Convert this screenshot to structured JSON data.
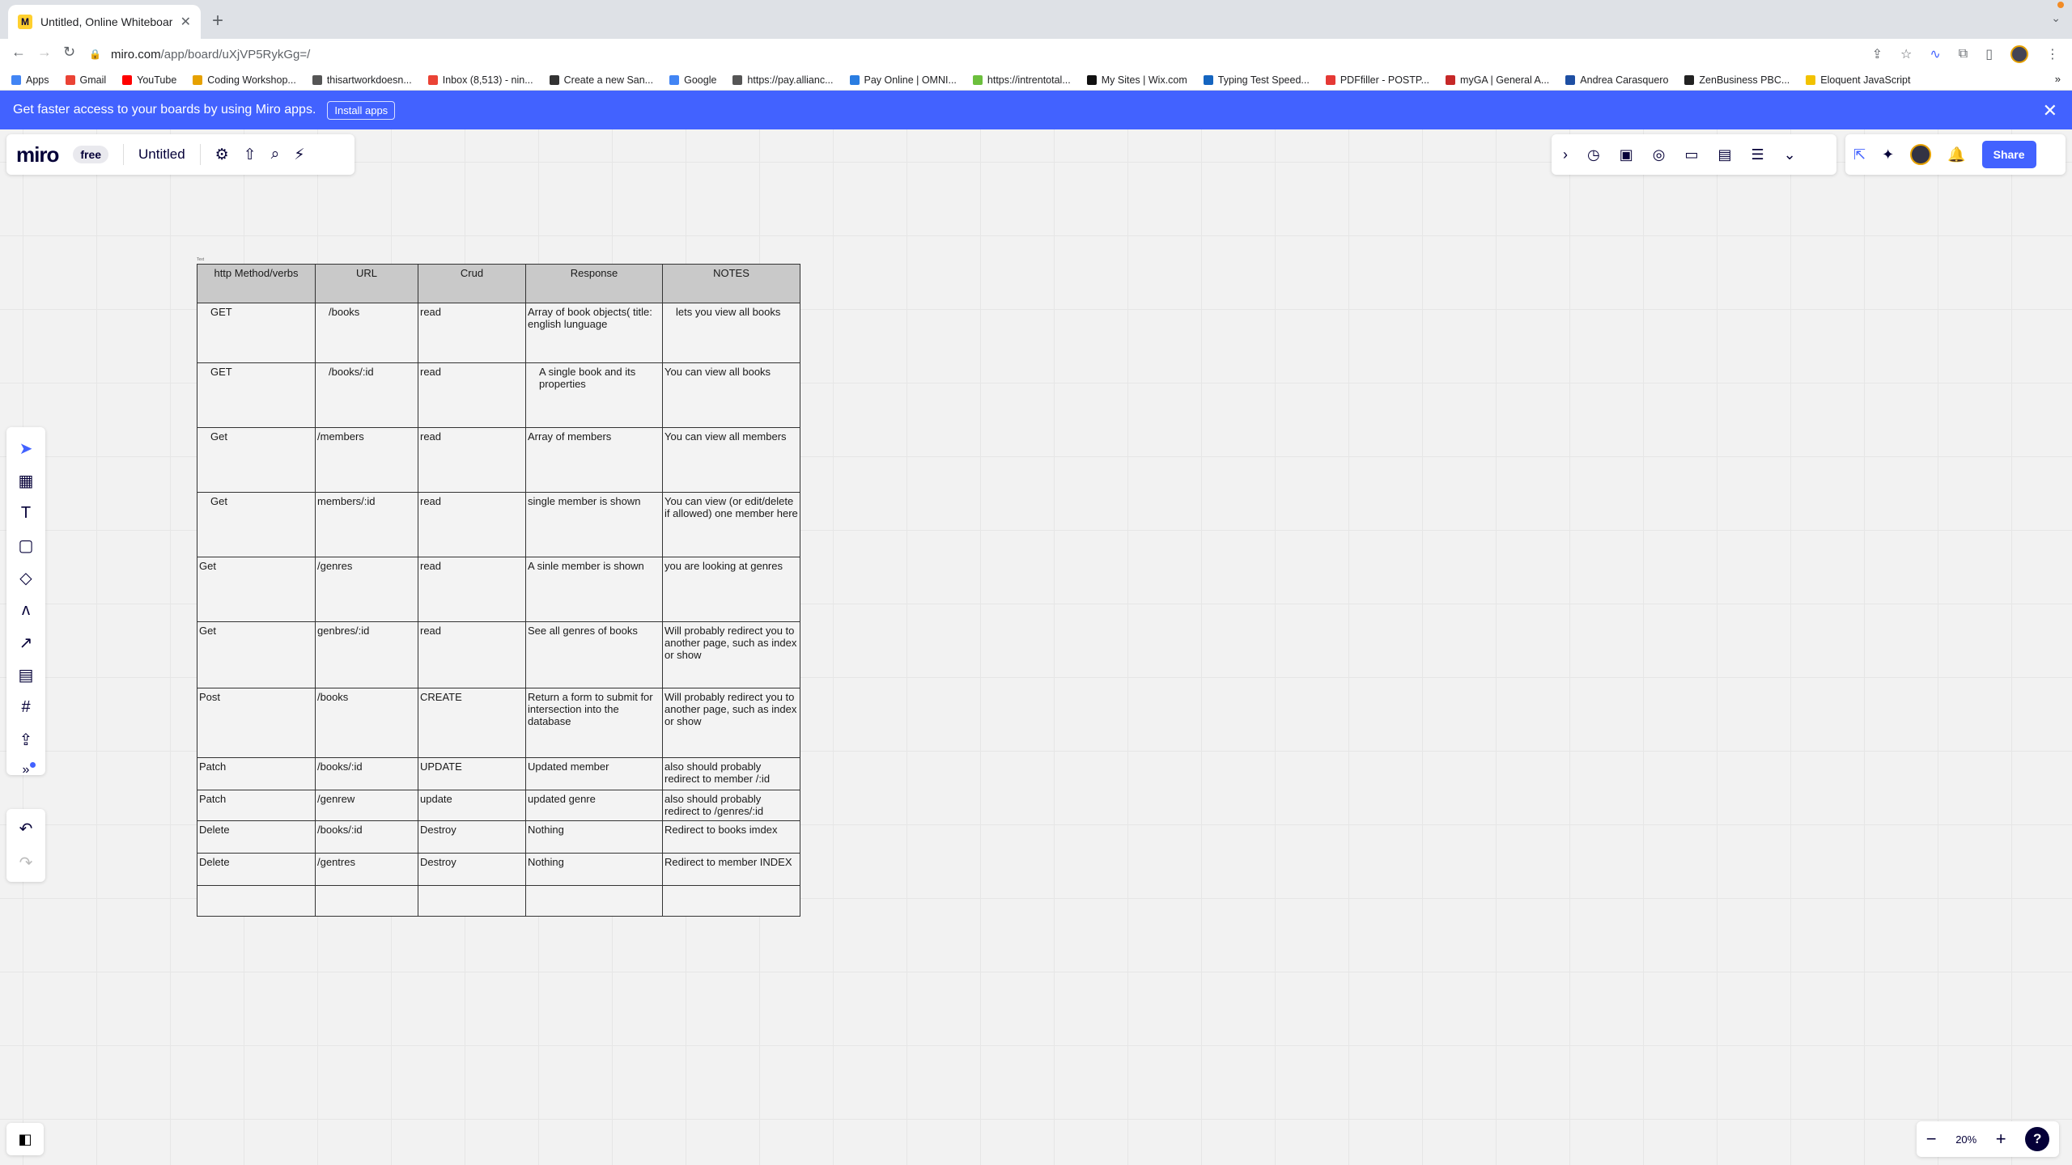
{
  "browser": {
    "tab_title": "Untitled, Online Whiteboard for",
    "url_host": "miro.com",
    "url_path": "/app/board/uXjVP5RykGg=/",
    "bookmarks": [
      {
        "label": "Apps",
        "color": "#4285f4"
      },
      {
        "label": "Gmail",
        "color": "#ea4335"
      },
      {
        "label": "YouTube",
        "color": "#ff0000"
      },
      {
        "label": "Coding Workshop...",
        "color": "#e6a100"
      },
      {
        "label": "thisartworkdoesn...",
        "color": "#555555"
      },
      {
        "label": "Inbox (8,513) - nin...",
        "color": "#ea4335"
      },
      {
        "label": "Create a new San...",
        "color": "#333333"
      },
      {
        "label": "Google",
        "color": "#4285f4"
      },
      {
        "label": "https://pay.allianc...",
        "color": "#555555"
      },
      {
        "label": "Pay Online | OMNI...",
        "color": "#2a7de1"
      },
      {
        "label": "https://intrentotal...",
        "color": "#6cbf3d"
      },
      {
        "label": "My Sites | Wix.com",
        "color": "#111111"
      },
      {
        "label": "Typing Test Speed...",
        "color": "#1565c0"
      },
      {
        "label": "PDFfiller - POSTP...",
        "color": "#e53935"
      },
      {
        "label": "myGA | General A...",
        "color": "#c62828"
      },
      {
        "label": "Andrea Carasquero",
        "color": "#1e4fa3"
      },
      {
        "label": "ZenBusiness PBC...",
        "color": "#222222"
      },
      {
        "label": "Eloquent JavaScript",
        "color": "#f2c200"
      }
    ]
  },
  "banner": {
    "text": "Get faster access to your boards by using Miro apps.",
    "button": "Install apps"
  },
  "miro": {
    "logo": "miro",
    "plan": "free",
    "board_title": "Untitled",
    "share": "Share",
    "zoom": "20%",
    "help": "?"
  },
  "table": {
    "tiny_label": "Text",
    "headers": [
      "http Method/verbs",
      "URL",
      "Crud",
      "Response",
      "NOTES"
    ],
    "rows": [
      [
        "GET",
        "/books",
        "read",
        "Array of book objects( title: english lunguage",
        "lets you view all books"
      ],
      [
        "GET",
        "/books/:id",
        "read",
        "A single book and its properties",
        "You can view all books"
      ],
      [
        "Get",
        "/members",
        "read",
        "Array of members",
        "You can view all members"
      ],
      [
        "Get",
        "members/:id",
        "read",
        "single member is shown",
        "You can view (or edit/delete if allowed) one member here"
      ],
      [
        "Get",
        "/genres",
        "read",
        "A sinle member is shown",
        "you are looking at genres"
      ],
      [
        "Get",
        "genbres/:id",
        "read",
        "See all genres of books",
        "Will probably redirect you to another page, such as index or show"
      ],
      [
        "Post",
        "/books",
        "CREATE",
        "Return a form to submit for intersection into the database",
        "Will probably redirect you to another page, such as index or show"
      ],
      [
        "Patch",
        "/books/:id",
        "UPDATE",
        "Updated member",
        "also should probably redirect to member /:id"
      ],
      [
        "Patch",
        "/genrew",
        "update",
        "updated genre",
        "also should probably redirect to /genres/:id"
      ],
      [
        "Delete",
        "/books/:id",
        "Destroy",
        "Nothing",
        "Redirect to books imdex"
      ],
      [
        "Delete",
        "/gentres",
        "Destroy",
        "Nothing",
        "Redirect to member INDEX"
      ],
      [
        "",
        "",
        "",
        "",
        ""
      ]
    ]
  }
}
